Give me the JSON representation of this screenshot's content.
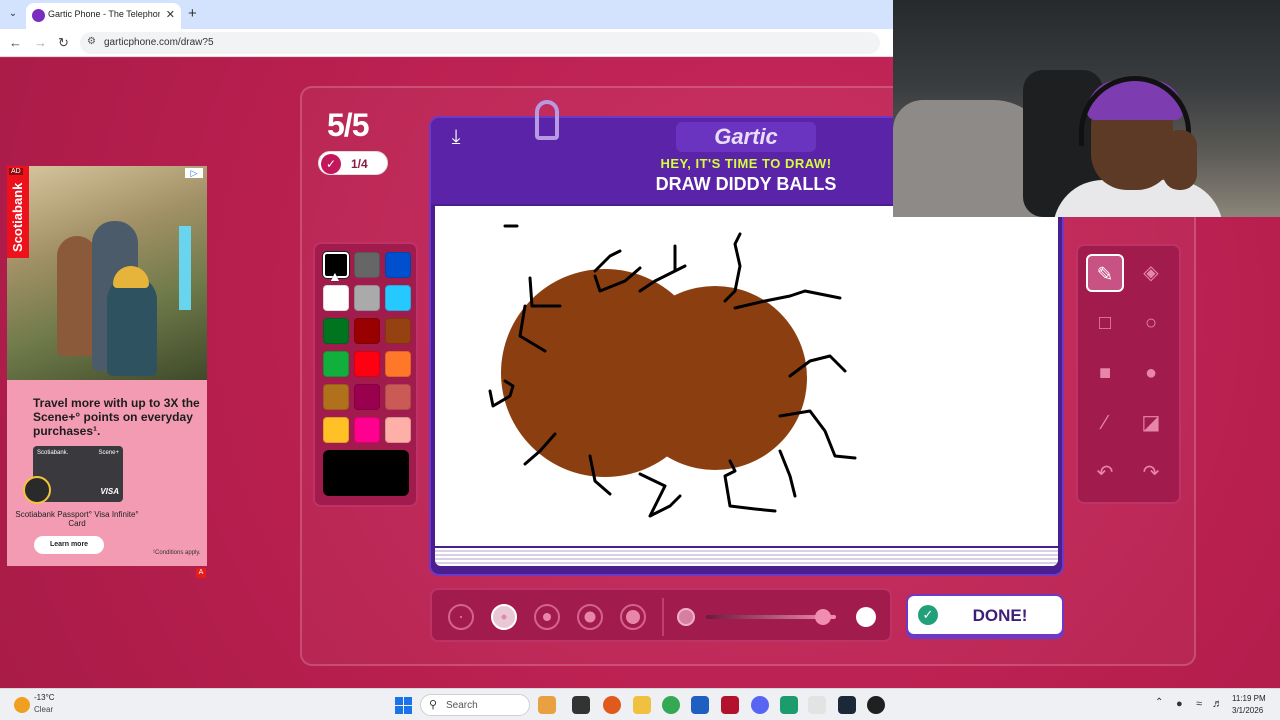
{
  "browser": {
    "tab_title": "Gartic Phone - The Telephone G",
    "url": "garticphone.com/draw?5"
  },
  "ad": {
    "tag": "AD",
    "brand": "Scotiabank",
    "headline": "Travel more with up to 3X the Scene+° points on everyday purchases¹.",
    "card_bank": "Scotiabank.",
    "card_scene": "Scene+",
    "card_visa": "VISA",
    "card_name": "Scotiabank Passport° Visa Infinite° Card",
    "cta": "Learn more",
    "conditions": "¹Conditions apply.",
    "mark": "A"
  },
  "game": {
    "round": "5/5",
    "players_done": "1/4",
    "logo": "Gartic",
    "prompt_hint": "HEY, IT'S TIME TO DRAW!",
    "prompt": "DRAW DIDDY BALLS",
    "done_label": "DONE!"
  },
  "palette": {
    "selected": "#000000",
    "colors": [
      "#000000",
      "#666666",
      "#0050cd",
      "#ffffff",
      "#aaaaaa",
      "#26c9ff",
      "#017420",
      "#990000",
      "#964112",
      "#11b03c",
      "#ff0013",
      "#ff7829",
      "#b0701c",
      "#99004e",
      "#cb5a57",
      "#ffc126",
      "#ff008f",
      "#feafa8"
    ]
  },
  "drawing": {
    "fill_color": "#8b3f10",
    "stroke_color": "#000000"
  },
  "tools": [
    {
      "name": "pencil-tool-icon",
      "glyph": "✎",
      "active": true
    },
    {
      "name": "eraser-tool-icon",
      "glyph": "◈",
      "active": false
    },
    {
      "name": "rectangle-outline-tool-icon",
      "glyph": "□",
      "active": false
    },
    {
      "name": "circle-outline-tool-icon",
      "glyph": "○",
      "active": false
    },
    {
      "name": "rectangle-fill-tool-icon",
      "glyph": "■",
      "active": false
    },
    {
      "name": "circle-fill-tool-icon",
      "glyph": "●",
      "active": false
    },
    {
      "name": "line-tool-icon",
      "glyph": "⁄",
      "active": false
    },
    {
      "name": "fill-bucket-tool-icon",
      "glyph": "◪",
      "active": false
    },
    {
      "name": "undo-icon",
      "glyph": "↶",
      "active": false
    },
    {
      "name": "redo-icon",
      "glyph": "↷",
      "active": false
    }
  ],
  "brush": {
    "sizes": 5,
    "selected_size_index": 1,
    "opacity": 0.9
  },
  "taskbar": {
    "weather_temp": "-13°C",
    "weather_desc": "Clear",
    "search_placeholder": "Search",
    "time": "11:19 PM",
    "date": "3/1/2026"
  }
}
